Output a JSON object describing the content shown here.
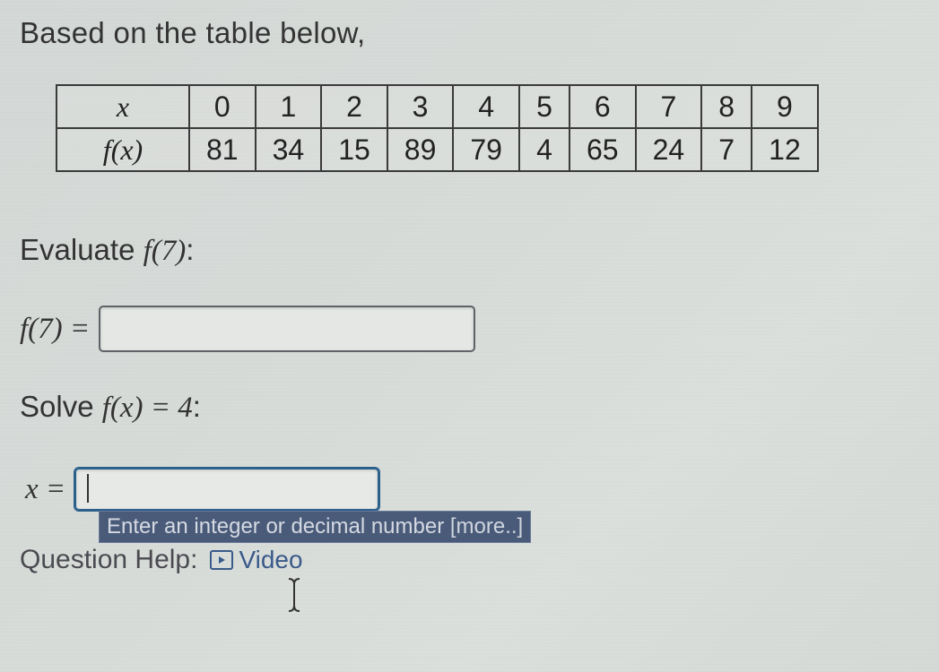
{
  "intro": "Based on the table below,",
  "table": {
    "row_headers": {
      "x": "x",
      "fx": "f(x)"
    },
    "x_values": [
      "0",
      "1",
      "2",
      "3",
      "4",
      "5",
      "6",
      "7",
      "8",
      "9"
    ],
    "fx_values": [
      "81",
      "34",
      "15",
      "89",
      "79",
      "4",
      "65",
      "24",
      "7",
      "12"
    ]
  },
  "evaluate": {
    "prompt_prefix": "Evaluate ",
    "prompt_expr": "f(7)",
    "prompt_suffix": ":",
    "answer_label": "f(7) =",
    "answer_value": ""
  },
  "solve": {
    "prompt_prefix": "Solve ",
    "prompt_expr": "f(x) = 4",
    "prompt_suffix": ":",
    "answer_label": "x =",
    "answer_value": "",
    "hint_text": "Enter an integer or decimal number ",
    "hint_more": "[more..]"
  },
  "help": {
    "label": "Question Help:",
    "video_label": "Video"
  }
}
